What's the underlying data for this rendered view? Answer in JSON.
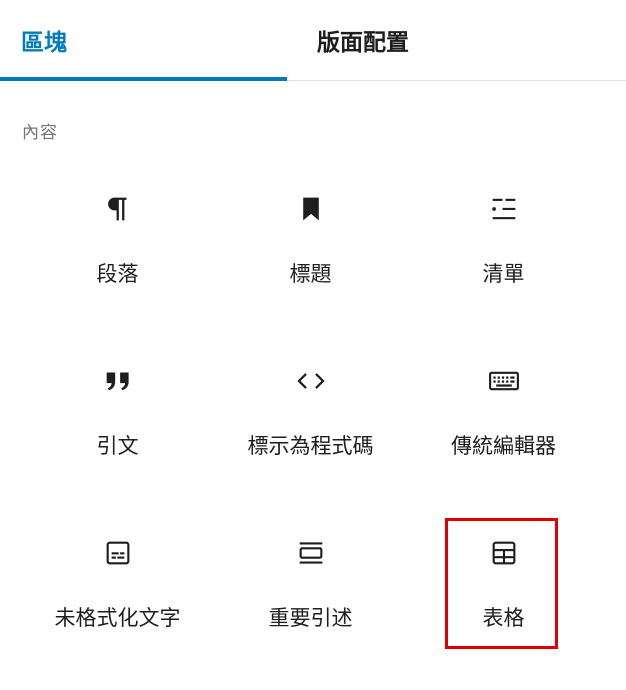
{
  "tabs": {
    "blocks_label": "區塊",
    "layout_label": "版面配置"
  },
  "section": {
    "title": "內容"
  },
  "blocks": [
    {
      "label": "段落",
      "icon": "paragraph-icon"
    },
    {
      "label": "標題",
      "icon": "heading-bookmark-icon"
    },
    {
      "label": "清單",
      "icon": "list-icon"
    },
    {
      "label": "引文",
      "icon": "quote-icon"
    },
    {
      "label": "標示為程式碼",
      "icon": "code-icon"
    },
    {
      "label": "傳統編輯器",
      "icon": "keyboard-icon"
    },
    {
      "label": "未格式化文字",
      "icon": "preformatted-icon"
    },
    {
      "label": "重要引述",
      "icon": "pullquote-icon"
    },
    {
      "label": "表格",
      "icon": "table-icon"
    }
  ],
  "colors": {
    "accent": "#007cba",
    "text": "#1e1e1e",
    "muted": "#757575",
    "highlight": "#e00000"
  }
}
